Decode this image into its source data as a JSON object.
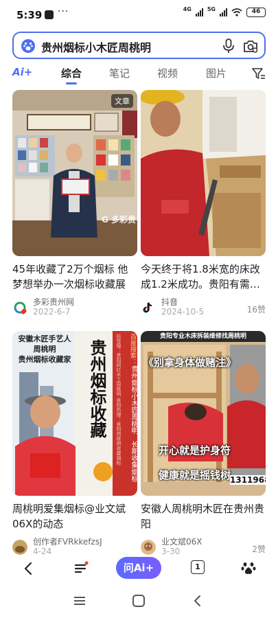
{
  "status": {
    "time": "5:39",
    "dots": "···",
    "net1": "4G",
    "net2": "5G",
    "battery": "46"
  },
  "search": {
    "query": "贵州烟标小木匠周桃明"
  },
  "tabs": {
    "ai": "Ai+",
    "items": [
      "综合",
      "笔记",
      "视频",
      "图片"
    ],
    "active": "综合"
  },
  "cards": [
    {
      "title": "45年收藏了2万个烟标 他梦想举办一次烟标收藏展",
      "badge": "文章",
      "watermark": "G 多彩贵",
      "source": "多彩贵州网",
      "date": "2022-6-7",
      "likes": ""
    },
    {
      "title": "今天终于将1.8米宽的床改成1.2米成功。贵阳有需…",
      "source": "抖音",
      "date": "2024-10-5",
      "likes": "16赞"
    },
    {
      "title": "周桃明爱集烟标@业文斌06X的动态",
      "overlay_lines": [
        "安徽木匠手艺人",
        "周桃明",
        "贵州烟标收藏家"
      ],
      "calligraphy": "贵州烟标收藏",
      "banner_top": "百度搜索：",
      "banner_mid": "贵州烟标小木匠周桃明",
      "banner_bottom": "长期收集烟标",
      "side_text": "抖音搜：贵阳网红木工周桃明 贵阳热搜：贵阳周桃明收藏烟标",
      "source": "创作者FVRkkefzsJ",
      "date": "4-24",
      "likes": ""
    },
    {
      "title": "安徽人周桃明木匠在贵州贵阳",
      "top_caption": "贵阳专业木床拆装维修找周桃明",
      "quote": "《别拿身体做赌注》",
      "line1": "开心就是护身符",
      "line2": "健康就是摇钱树",
      "phone": "1311968",
      "source": "业文斌06X",
      "date": "3-30",
      "likes": "2赞"
    }
  ],
  "toolbar": {
    "ask_ai": "问Ai+",
    "tab_count": "1"
  },
  "colors": {
    "accent": "#4e6ef2",
    "title": "#1f1f1f",
    "meta": "#aaaaaa"
  }
}
